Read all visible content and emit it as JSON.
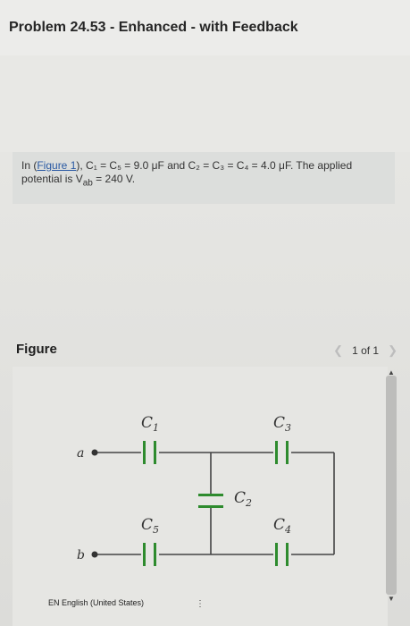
{
  "header": {
    "title": "Problem 24.53 - Enhanced - with Feedback"
  },
  "problem": {
    "prefix": "In (",
    "figure_link": "Figure 1",
    "given": "), C₁ = C₅ = 9.0 μF and C₂ = C₃ = C₄ = 4.0 μF. The applied potential is V",
    "subscript": "ab",
    "tail": " = 240 V."
  },
  "figure": {
    "label": "Figure",
    "pager": {
      "current": "1 of 1"
    },
    "circuit": {
      "terminal_a": "a",
      "terminal_b": "b",
      "capacitors": [
        {
          "name": "C",
          "sub": "1"
        },
        {
          "name": "C",
          "sub": "3"
        },
        {
          "name": "C",
          "sub": "2"
        },
        {
          "name": "C",
          "sub": "5"
        },
        {
          "name": "C",
          "sub": "4"
        }
      ]
    }
  },
  "footer": {
    "language": "EN English (United States)"
  },
  "colors": {
    "link": "#2a5aa3",
    "capacitor": "#2e8b2e",
    "wire": "#444444"
  }
}
